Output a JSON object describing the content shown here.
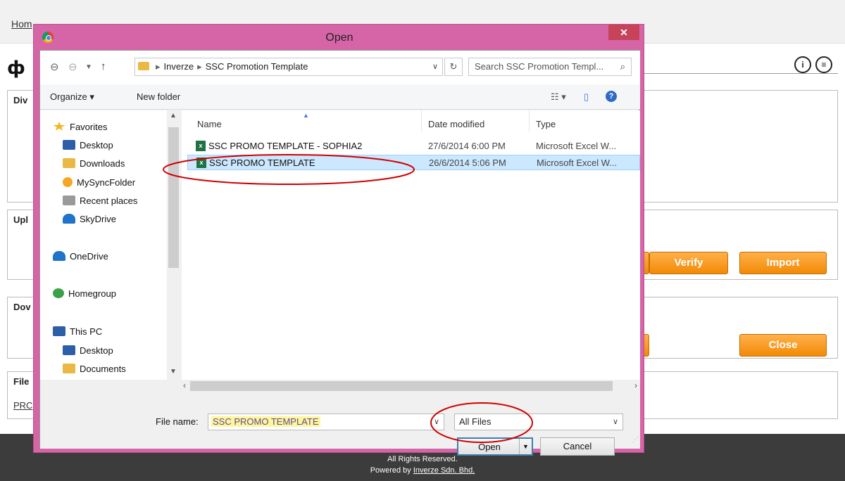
{
  "background": {
    "breadcrumb": "Hom",
    "logo": "ф",
    "panels": {
      "p1_title": "Div",
      "p2_title": "Upl",
      "p3_title": "Dov",
      "p4_title": "File",
      "p4_link": "PRC"
    },
    "buttons": {
      "verify": "Verify",
      "import": "Import",
      "close": "Close"
    },
    "footer": {
      "line1": "All Rights Reserved.",
      "line2_prefix": "Powered by ",
      "company": "Inverze Sdn. Bhd."
    }
  },
  "dialog": {
    "title": "Open",
    "close_glyph": "✕",
    "address": {
      "parts": [
        "Inverze",
        "SSC Promotion Template"
      ]
    },
    "search_placeholder": "Search SSC Promotion Templ...",
    "toolbar": {
      "organize": "Organize ▾",
      "new_folder": "New folder",
      "help": "?"
    },
    "nav_items": [
      {
        "label": "Favorites",
        "color": "#f2b51c"
      },
      {
        "label": "Desktop",
        "color": "#2c5fa8"
      },
      {
        "label": "Downloads",
        "color": "#e9b845"
      },
      {
        "label": "MySyncFolder",
        "color": "#f5a623"
      },
      {
        "label": "Recent places",
        "color": "#8a8a8a"
      },
      {
        "label": "SkyDrive",
        "color": "#1f73c9"
      },
      {
        "label": "OneDrive",
        "color": "#1f73c9"
      },
      {
        "label": "Homegroup",
        "color": "#3aa14a"
      },
      {
        "label": "This PC",
        "color": "#2c5fa8"
      },
      {
        "label": "Desktop",
        "color": "#2c5fa8"
      },
      {
        "label": "Documents",
        "color": "#e9b845"
      }
    ],
    "columns": {
      "name": "Name",
      "date": "Date modified",
      "type": "Type"
    },
    "files": [
      {
        "name": "SSC PROMO TEMPLATE - SOPHIA2",
        "date": "27/6/2014 6:00 PM",
        "type": "Microsoft Excel W..."
      },
      {
        "name": "SSC PROMO TEMPLATE",
        "date": "26/6/2014 5:06 PM",
        "type": "Microsoft Excel W..."
      }
    ],
    "file_name_label": "File name:",
    "file_name_value": "SSC PROMO TEMPLATE",
    "file_type": "All Files",
    "open_label": "Open",
    "cancel_label": "Cancel"
  },
  "colors": {
    "dialog_frame": "#d565a6",
    "selection": "#cce8ff",
    "annotation": "#d00000",
    "accent_button": "#f28a06"
  }
}
